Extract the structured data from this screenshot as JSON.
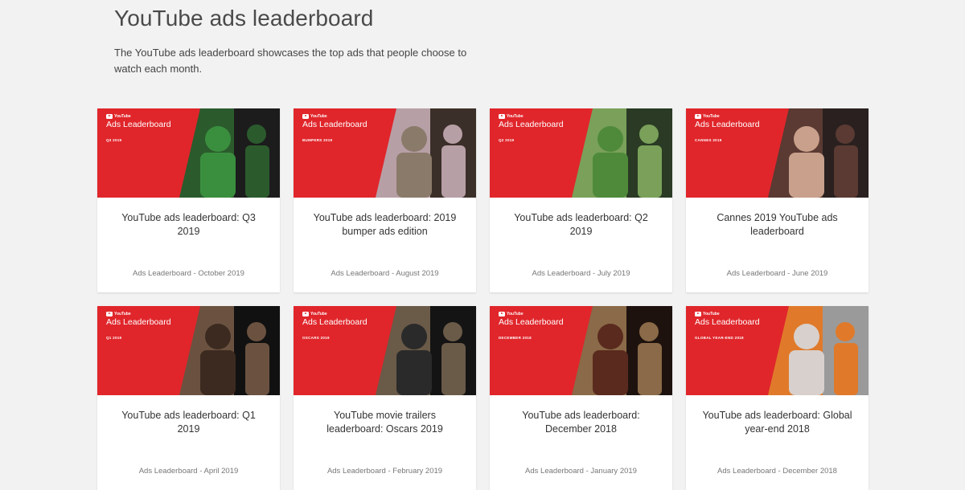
{
  "page": {
    "title": "YouTube ads leaderboard",
    "description": "The YouTube ads leaderboard showcases the top ads that people choose to watch each month."
  },
  "cards": [
    {
      "badge_brand": "YouTube",
      "badge_title": "Ads Leaderboard",
      "tag": "Q3 2019",
      "title": "YouTube ads leaderboard: Q3 2019",
      "meta": "Ads Leaderboard - October 2019",
      "colors": {
        "a": "#3a8f3e",
        "b": "#2b5b2d",
        "c": "#1c1c1c"
      }
    },
    {
      "badge_brand": "YouTube",
      "badge_title": "Ads Leaderboard",
      "tag": "BUMPERS 2019",
      "title": "YouTube ads leaderboard: 2019 bumper ads edition",
      "meta": "Ads Leaderboard - August 2019",
      "colors": {
        "a": "#8a7a6a",
        "b": "#b79fa6",
        "c": "#3b2f29"
      }
    },
    {
      "badge_brand": "YouTube",
      "badge_title": "Ads Leaderboard",
      "tag": "Q2 2019",
      "title": "YouTube ads leaderboard: Q2 2019",
      "meta": "Ads Leaderboard - July 2019",
      "colors": {
        "a": "#4e8a3a",
        "b": "#7aa05a",
        "c": "#2a3a24"
      }
    },
    {
      "badge_brand": "YouTube",
      "badge_title": "Ads Leaderboard",
      "tag": "CANNES 2019",
      "title": "Cannes 2019 YouTube ads leaderboard",
      "meta": "Ads Leaderboard - June 2019",
      "colors": {
        "a": "#c9a08c",
        "b": "#5a3a32",
        "c": "#2a2020"
      }
    },
    {
      "badge_brand": "YouTube",
      "badge_title": "Ads Leaderboard",
      "tag": "Q1 2019",
      "title": "YouTube ads leaderboard: Q1 2019",
      "meta": "Ads Leaderboard - April 2019",
      "colors": {
        "a": "#3c2a20",
        "b": "#6b5240",
        "c": "#111111"
      }
    },
    {
      "badge_brand": "YouTube",
      "badge_title": "Ads Leaderboard",
      "tag": "OSCARS 2019",
      "title": "YouTube movie trailers leaderboard: Oscars 2019",
      "meta": "Ads Leaderboard - February 2019",
      "colors": {
        "a": "#2a2a2a",
        "b": "#6a5a48",
        "c": "#141414"
      }
    },
    {
      "badge_brand": "YouTube",
      "badge_title": "Ads Leaderboard",
      "tag": "DECEMBER 2018",
      "title": "YouTube ads leaderboard: December 2018",
      "meta": "Ads Leaderboard - January 2019",
      "colors": {
        "a": "#5a2a1e",
        "b": "#8a6a48",
        "c": "#1e120e"
      }
    },
    {
      "badge_brand": "YouTube",
      "badge_title": "Ads Leaderboard",
      "tag": "GLOBAL YEAR-END 2018",
      "title": "YouTube ads leaderboard: Global year-end 2018",
      "meta": "Ads Leaderboard - December 2018",
      "colors": {
        "a": "#d8d0cc",
        "b": "#e07a2a",
        "c": "#9a9a9a"
      }
    }
  ],
  "theme": {
    "red": "#e0262b",
    "background": "#f2f2f2"
  }
}
